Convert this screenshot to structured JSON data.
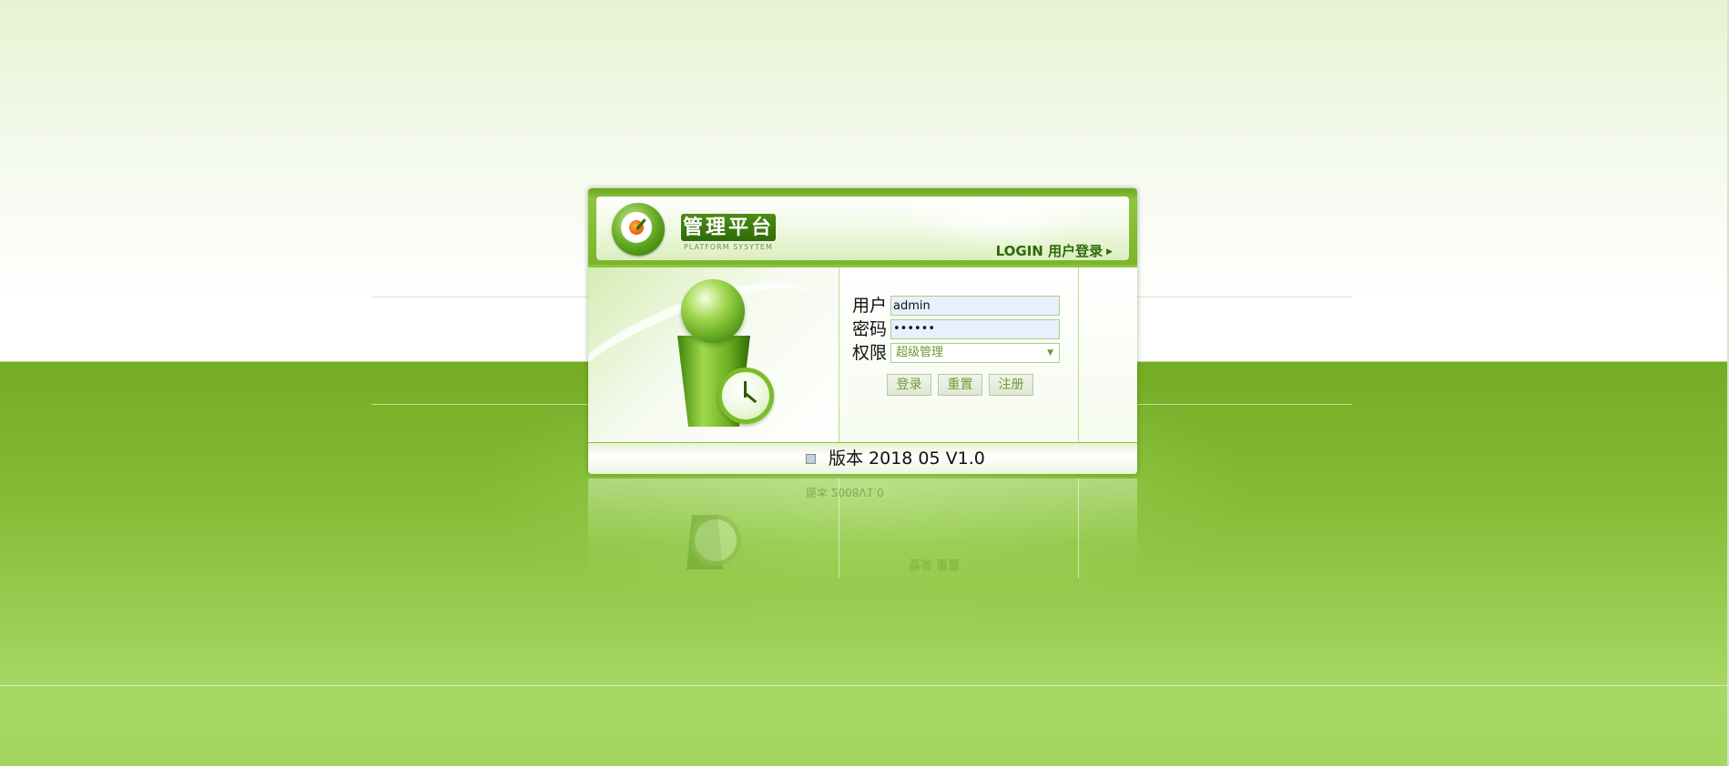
{
  "header": {
    "brand_title": "管理平台",
    "brand_subtitle": "PLATFORM SYSYTEM",
    "login_title": "LOGIN 用户登录",
    "arrow_icon": "triangle-right-icon"
  },
  "form": {
    "user_label": "用户",
    "user_value": "admin",
    "password_label": "密码",
    "password_value": "••••••",
    "role_label": "权限",
    "role_selected": "超级管理",
    "dropdown_icon": "triangle-down-icon"
  },
  "buttons": {
    "login": "登录",
    "reset": "重置",
    "register": "注册"
  },
  "footer": {
    "version_text": "版本 2018 05 V1.0",
    "icon": "document-icon"
  },
  "reflection": {
    "version_text": "版本 2008V1.0",
    "buttons_text": "登录  重置"
  },
  "colors": {
    "brand_green": "#5da51c",
    "dark_green": "#2f6a07",
    "bg_green_top": "#74ac24",
    "bg_green_bottom": "#a3d65f"
  }
}
